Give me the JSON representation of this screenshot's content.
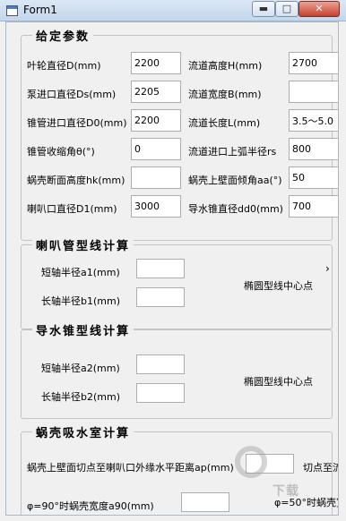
{
  "window": {
    "title": "Form1",
    "min_label": "▬",
    "max_label": "□",
    "close_label": "✕"
  },
  "params": {
    "title": "给定参数",
    "impeller_diameter": {
      "label": "叶轮直径D(mm)",
      "value": "2200"
    },
    "runner_height": {
      "label": "流道高度H(mm)",
      "value": "2700"
    },
    "pump_inlet_diameter": {
      "label": "泵进口直径Ds(mm)",
      "value": "2205"
    },
    "runner_width": {
      "label": "流道宽度B(mm)",
      "value": ""
    },
    "cone_inlet_diameter": {
      "label": "锥管进口直径D0(mm)",
      "value": "2200"
    },
    "runner_length": {
      "label": "流道长度L(mm)",
      "value": "3.5～5.0"
    },
    "cone_angle": {
      "label": "锥管收缩角θ(°)",
      "value": "0"
    },
    "inlet_upper_arc": {
      "label": "流道进口上弧半径rs",
      "value": "800"
    },
    "volute_section_height": {
      "label": "蜗壳断面高度hk(mm)",
      "value": ""
    },
    "volute_wall_angle": {
      "label": "蜗壳上壁面倾角aa(°)",
      "value": "50"
    },
    "bellmouth_diameter": {
      "label": "喇叭口直径D1(mm)",
      "value": "3000"
    },
    "guide_cone_diameter": {
      "label": "导水锥直径dd0(mm)",
      "value": "700"
    }
  },
  "bellmouth": {
    "title": "喇叭管型线计算",
    "minor_axis": {
      "label": "短轴半径a1(mm)",
      "value": ""
    },
    "major_axis": {
      "label": "长轴半径b1(mm)",
      "value": ""
    },
    "center_label": "椭圆型线中心点",
    "overflow_mark": "›"
  },
  "guide_cone": {
    "title": "导水锥型线计算",
    "minor_axis": {
      "label": "短轴半径a2(mm)",
      "value": ""
    },
    "major_axis": {
      "label": "长轴半径b2(mm)",
      "value": ""
    },
    "center_label": "椭圆型线中心点"
  },
  "volute": {
    "title": "蜗壳吸水室计算",
    "tangent_distance": {
      "label": "蜗壳上壁面切点至喇叭口外缘水平距离ap(mm)",
      "value": ""
    },
    "tangent_to_flow": "切点至流",
    "width_90": {
      "label": "φ=90°时蜗壳宽度a90(mm)",
      "value": ""
    },
    "width_50": "φ=50°时蜗壳宽"
  },
  "watermark": {
    "text": "下载"
  }
}
